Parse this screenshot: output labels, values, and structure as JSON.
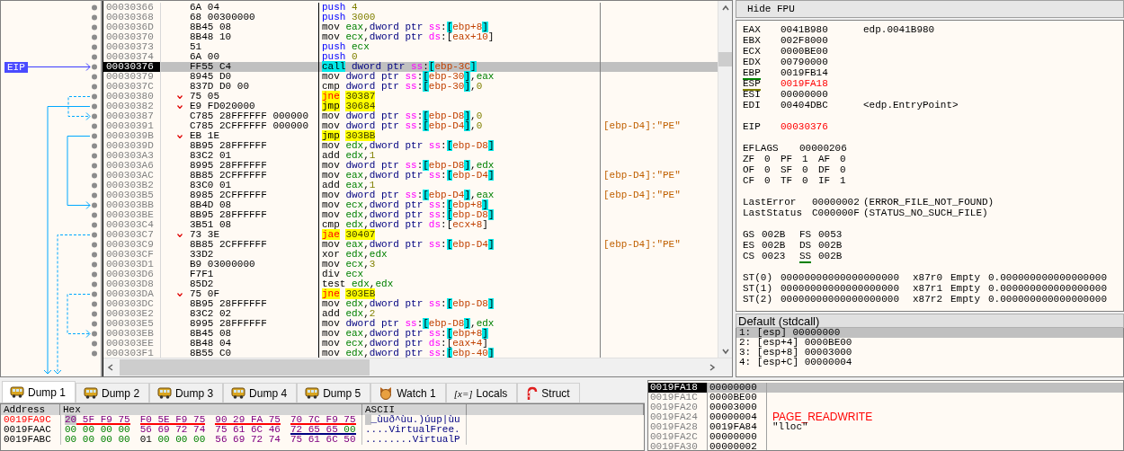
{
  "disassembly": {
    "eip_label": "EIP",
    "rows": [
      {
        "address": "00030366",
        "bytes": "6A 04",
        "branch": false,
        "selected": false,
        "tokens": [
          {
            "kind": "push",
            "text": "push "
          },
          {
            "kind": "num",
            "text": "4"
          }
        ]
      },
      {
        "address": "00030368",
        "bytes": "68 00300000",
        "branch": false,
        "selected": false,
        "tokens": [
          {
            "kind": "push",
            "text": "push "
          },
          {
            "kind": "num",
            "text": "3000"
          }
        ]
      },
      {
        "address": "0003036D",
        "bytes": "8B45 08",
        "branch": false,
        "selected": false,
        "tokens": [
          {
            "kind": "op",
            "text": "mov "
          },
          {
            "kind": "reg",
            "text": "eax"
          },
          {
            "kind": "punct",
            "text": ","
          },
          {
            "kind": "ptr",
            "text": "dword ptr "
          },
          {
            "kind": "seg",
            "text": "ss"
          },
          {
            "kind": "punct",
            "text": ":"
          },
          {
            "kind": "bracket",
            "text": "["
          },
          {
            "kind": "mem",
            "text": "ebp+8"
          },
          {
            "kind": "bracket",
            "text": "]"
          }
        ]
      },
      {
        "address": "00030370",
        "bytes": "8B48 10",
        "branch": false,
        "selected": false,
        "tokens": [
          {
            "kind": "op",
            "text": "mov "
          },
          {
            "kind": "reg",
            "text": "ecx"
          },
          {
            "kind": "punct",
            "text": ","
          },
          {
            "kind": "ptr",
            "text": "dword ptr "
          },
          {
            "kind": "seg",
            "text": "ds"
          },
          {
            "kind": "punct",
            "text": ":["
          },
          {
            "kind": "mem",
            "text": "eax+10"
          },
          {
            "kind": "punct",
            "text": "]"
          }
        ]
      },
      {
        "address": "00030373",
        "bytes": "51",
        "branch": false,
        "selected": false,
        "tokens": [
          {
            "kind": "push",
            "text": "push "
          },
          {
            "kind": "reg",
            "text": "ecx"
          }
        ]
      },
      {
        "address": "00030374",
        "bytes": "6A 00",
        "branch": false,
        "selected": false,
        "tokens": [
          {
            "kind": "push",
            "text": "push "
          },
          {
            "kind": "num",
            "text": "0"
          }
        ]
      },
      {
        "address": "00030376",
        "bytes": "FF55 C4",
        "branch": false,
        "selected": true,
        "tokens": [
          {
            "kind": "call",
            "text": "call"
          },
          {
            "kind": "ptr",
            "text": "dword ptr "
          },
          {
            "kind": "seg",
            "text": "ss"
          },
          {
            "kind": "punct",
            "text": ":"
          },
          {
            "kind": "bracket",
            "text": "["
          },
          {
            "kind": "mem",
            "text": "ebp-3C"
          },
          {
            "kind": "bracket",
            "text": "]"
          }
        ]
      },
      {
        "address": "00030379",
        "bytes": "8945 D0",
        "branch": false,
        "selected": false,
        "tokens": [
          {
            "kind": "op",
            "text": "mov "
          },
          {
            "kind": "ptr",
            "text": "dword ptr "
          },
          {
            "kind": "seg",
            "text": "ss"
          },
          {
            "kind": "punct",
            "text": ":"
          },
          {
            "kind": "bracket",
            "text": "["
          },
          {
            "kind": "mem",
            "text": "ebp-30"
          },
          {
            "kind": "bracket",
            "text": "]"
          },
          {
            "kind": "punct",
            "text": ","
          },
          {
            "kind": "reg",
            "text": "eax"
          }
        ]
      },
      {
        "address": "0003037C",
        "bytes": "837D D0 00",
        "branch": false,
        "selected": false,
        "tokens": [
          {
            "kind": "op",
            "text": "cmp "
          },
          {
            "kind": "ptr",
            "text": "dword ptr "
          },
          {
            "kind": "seg",
            "text": "ss"
          },
          {
            "kind": "punct",
            "text": ":"
          },
          {
            "kind": "bracket",
            "text": "["
          },
          {
            "kind": "mem",
            "text": "ebp-30"
          },
          {
            "kind": "bracket",
            "text": "]"
          },
          {
            "kind": "punct",
            "text": ","
          },
          {
            "kind": "num",
            "text": "0"
          }
        ]
      },
      {
        "address": "00030380",
        "bytes": "75 05",
        "branch": true,
        "selected": false,
        "tokens": [
          {
            "kind": "jcc",
            "text": "jne"
          },
          {
            "kind": "target",
            "text": "30387"
          }
        ]
      },
      {
        "address": "00030382",
        "bytes": "E9 FD020000",
        "branch": true,
        "selected": false,
        "tokens": [
          {
            "kind": "jmp",
            "text": "jmp"
          },
          {
            "kind": "target",
            "text": "30684"
          }
        ]
      },
      {
        "address": "00030387",
        "bytes": "C785 28FFFFFF 000000",
        "branch": false,
        "selected": false,
        "tokens": [
          {
            "kind": "op",
            "text": "mov "
          },
          {
            "kind": "ptr",
            "text": "dword ptr "
          },
          {
            "kind": "seg",
            "text": "ss"
          },
          {
            "kind": "punct",
            "text": ":"
          },
          {
            "kind": "bracket",
            "text": "["
          },
          {
            "kind": "mem",
            "text": "ebp-D8"
          },
          {
            "kind": "bracket",
            "text": "]"
          },
          {
            "kind": "punct",
            "text": ","
          },
          {
            "kind": "num",
            "text": "0"
          }
        ]
      },
      {
        "address": "00030391",
        "bytes": "C785 2CFFFFFF 000000",
        "branch": false,
        "selected": false,
        "tokens": [
          {
            "kind": "op",
            "text": "mov "
          },
          {
            "kind": "ptr",
            "text": "dword ptr "
          },
          {
            "kind": "seg",
            "text": "ss"
          },
          {
            "kind": "punct",
            "text": ":"
          },
          {
            "kind": "bracket",
            "text": "["
          },
          {
            "kind": "mem",
            "text": "ebp-D4"
          },
          {
            "kind": "bracket",
            "text": "]"
          },
          {
            "kind": "punct",
            "text": ","
          },
          {
            "kind": "num",
            "text": "0"
          }
        ],
        "comment": "[ebp-D4]:\"PE\""
      },
      {
        "address": "0003039B",
        "bytes": "EB 1E",
        "branch": true,
        "selected": false,
        "tokens": [
          {
            "kind": "jmp",
            "text": "jmp"
          },
          {
            "kind": "target",
            "text": "303BB"
          }
        ]
      },
      {
        "address": "0003039D",
        "bytes": "8B95 28FFFFFF",
        "branch": false,
        "selected": false,
        "tokens": [
          {
            "kind": "op",
            "text": "mov "
          },
          {
            "kind": "reg",
            "text": "edx"
          },
          {
            "kind": "punct",
            "text": ","
          },
          {
            "kind": "ptr",
            "text": "dword ptr "
          },
          {
            "kind": "seg",
            "text": "ss"
          },
          {
            "kind": "punct",
            "text": ":"
          },
          {
            "kind": "bracket",
            "text": "["
          },
          {
            "kind": "mem",
            "text": "ebp-D8"
          },
          {
            "kind": "bracket",
            "text": "]"
          }
        ]
      },
      {
        "address": "000303A3",
        "bytes": "83C2 01",
        "branch": false,
        "selected": false,
        "tokens": [
          {
            "kind": "op",
            "text": "add "
          },
          {
            "kind": "reg",
            "text": "edx"
          },
          {
            "kind": "punct",
            "text": ","
          },
          {
            "kind": "num",
            "text": "1"
          }
        ]
      },
      {
        "address": "000303A6",
        "bytes": "8995 28FFFFFF",
        "branch": false,
        "selected": false,
        "tokens": [
          {
            "kind": "op",
            "text": "mov "
          },
          {
            "kind": "ptr",
            "text": "dword ptr "
          },
          {
            "kind": "seg",
            "text": "ss"
          },
          {
            "kind": "punct",
            "text": ":"
          },
          {
            "kind": "bracket",
            "text": "["
          },
          {
            "kind": "mem",
            "text": "ebp-D8"
          },
          {
            "kind": "bracket",
            "text": "]"
          },
          {
            "kind": "punct",
            "text": ","
          },
          {
            "kind": "reg",
            "text": "edx"
          }
        ]
      },
      {
        "address": "000303AC",
        "bytes": "8B85 2CFFFFFF",
        "branch": false,
        "selected": false,
        "tokens": [
          {
            "kind": "op",
            "text": "mov "
          },
          {
            "kind": "reg",
            "text": "eax"
          },
          {
            "kind": "punct",
            "text": ","
          },
          {
            "kind": "ptr",
            "text": "dword ptr "
          },
          {
            "kind": "seg",
            "text": "ss"
          },
          {
            "kind": "punct",
            "text": ":"
          },
          {
            "kind": "bracket",
            "text": "["
          },
          {
            "kind": "mem",
            "text": "ebp-D4"
          },
          {
            "kind": "bracket",
            "text": "]"
          }
        ],
        "comment": "[ebp-D4]:\"PE\""
      },
      {
        "address": "000303B2",
        "bytes": "83C0 01",
        "branch": false,
        "selected": false,
        "tokens": [
          {
            "kind": "op",
            "text": "add "
          },
          {
            "kind": "reg",
            "text": "eax"
          },
          {
            "kind": "punct",
            "text": ","
          },
          {
            "kind": "num",
            "text": "1"
          }
        ]
      },
      {
        "address": "000303B5",
        "bytes": "8985 2CFFFFFF",
        "branch": false,
        "selected": false,
        "tokens": [
          {
            "kind": "op",
            "text": "mov "
          },
          {
            "kind": "ptr",
            "text": "dword ptr "
          },
          {
            "kind": "seg",
            "text": "ss"
          },
          {
            "kind": "punct",
            "text": ":"
          },
          {
            "kind": "bracket",
            "text": "["
          },
          {
            "kind": "mem",
            "text": "ebp-D4"
          },
          {
            "kind": "bracket",
            "text": "]"
          },
          {
            "kind": "punct",
            "text": ","
          },
          {
            "kind": "reg",
            "text": "eax"
          }
        ],
        "comment": "[ebp-D4]:\"PE\""
      },
      {
        "address": "000303BB",
        "bytes": "8B4D 08",
        "branch": false,
        "selected": false,
        "tokens": [
          {
            "kind": "op",
            "text": "mov "
          },
          {
            "kind": "reg",
            "text": "ecx"
          },
          {
            "kind": "punct",
            "text": ","
          },
          {
            "kind": "ptr",
            "text": "dword ptr "
          },
          {
            "kind": "seg",
            "text": "ss"
          },
          {
            "kind": "punct",
            "text": ":"
          },
          {
            "kind": "bracket",
            "text": "["
          },
          {
            "kind": "mem",
            "text": "ebp+8"
          },
          {
            "kind": "bracket",
            "text": "]"
          }
        ]
      },
      {
        "address": "000303BE",
        "bytes": "8B95 28FFFFFF",
        "branch": false,
        "selected": false,
        "tokens": [
          {
            "kind": "op",
            "text": "mov "
          },
          {
            "kind": "reg",
            "text": "edx"
          },
          {
            "kind": "punct",
            "text": ","
          },
          {
            "kind": "ptr",
            "text": "dword ptr "
          },
          {
            "kind": "seg",
            "text": "ss"
          },
          {
            "kind": "punct",
            "text": ":"
          },
          {
            "kind": "bracket",
            "text": "["
          },
          {
            "kind": "mem",
            "text": "ebp-D8"
          },
          {
            "kind": "bracket",
            "text": "]"
          }
        ]
      },
      {
        "address": "000303C4",
        "bytes": "3B51 08",
        "branch": false,
        "selected": false,
        "tokens": [
          {
            "kind": "op",
            "text": "cmp "
          },
          {
            "kind": "reg",
            "text": "edx"
          },
          {
            "kind": "punct",
            "text": ","
          },
          {
            "kind": "ptr",
            "text": "dword ptr "
          },
          {
            "kind": "seg",
            "text": "ds"
          },
          {
            "kind": "punct",
            "text": ":["
          },
          {
            "kind": "mem",
            "text": "ecx+8"
          },
          {
            "kind": "punct",
            "text": "]"
          }
        ]
      },
      {
        "address": "000303C7",
        "bytes": "73 3E",
        "branch": true,
        "selected": false,
        "tokens": [
          {
            "kind": "jcc",
            "text": "jae"
          },
          {
            "kind": "target",
            "text": "30407"
          }
        ]
      },
      {
        "address": "000303C9",
        "bytes": "8B85 2CFFFFFF",
        "branch": false,
        "selected": false,
        "tokens": [
          {
            "kind": "op",
            "text": "mov "
          },
          {
            "kind": "reg",
            "text": "eax"
          },
          {
            "kind": "punct",
            "text": ","
          },
          {
            "kind": "ptr",
            "text": "dword ptr "
          },
          {
            "kind": "seg",
            "text": "ss"
          },
          {
            "kind": "punct",
            "text": ":"
          },
          {
            "kind": "bracket",
            "text": "["
          },
          {
            "kind": "mem",
            "text": "ebp-D4"
          },
          {
            "kind": "bracket",
            "text": "]"
          }
        ],
        "comment": "[ebp-D4]:\"PE\""
      },
      {
        "address": "000303CF",
        "bytes": "33D2",
        "branch": false,
        "selected": false,
        "tokens": [
          {
            "kind": "op",
            "text": "xor "
          },
          {
            "kind": "reg",
            "text": "edx"
          },
          {
            "kind": "punct",
            "text": ","
          },
          {
            "kind": "reg",
            "text": "edx"
          }
        ]
      },
      {
        "address": "000303D1",
        "bytes": "B9 03000000",
        "branch": false,
        "selected": false,
        "tokens": [
          {
            "kind": "op",
            "text": "mov "
          },
          {
            "kind": "reg",
            "text": "ecx"
          },
          {
            "kind": "punct",
            "text": ","
          },
          {
            "kind": "num",
            "text": "3"
          }
        ]
      },
      {
        "address": "000303D6",
        "bytes": "F7F1",
        "branch": false,
        "selected": false,
        "tokens": [
          {
            "kind": "op",
            "text": "div "
          },
          {
            "kind": "reg",
            "text": "ecx"
          }
        ]
      },
      {
        "address": "000303D8",
        "bytes": "85D2",
        "branch": false,
        "selected": false,
        "tokens": [
          {
            "kind": "op",
            "text": "test "
          },
          {
            "kind": "reg",
            "text": "edx"
          },
          {
            "kind": "punct",
            "text": ","
          },
          {
            "kind": "reg",
            "text": "edx"
          }
        ]
      },
      {
        "address": "000303DA",
        "bytes": "75 0F",
        "branch": true,
        "selected": false,
        "tokens": [
          {
            "kind": "jcc",
            "text": "jne"
          },
          {
            "kind": "target",
            "text": "303EB"
          }
        ]
      },
      {
        "address": "000303DC",
        "bytes": "8B95 28FFFFFF",
        "branch": false,
        "selected": false,
        "tokens": [
          {
            "kind": "op",
            "text": "mov "
          },
          {
            "kind": "reg",
            "text": "edx"
          },
          {
            "kind": "punct",
            "text": ","
          },
          {
            "kind": "ptr",
            "text": "dword ptr "
          },
          {
            "kind": "seg",
            "text": "ss"
          },
          {
            "kind": "punct",
            "text": ":"
          },
          {
            "kind": "bracket",
            "text": "["
          },
          {
            "kind": "mem",
            "text": "ebp-D8"
          },
          {
            "kind": "bracket",
            "text": "]"
          }
        ]
      },
      {
        "address": "000303E2",
        "bytes": "83C2 02",
        "branch": false,
        "selected": false,
        "tokens": [
          {
            "kind": "op",
            "text": "add "
          },
          {
            "kind": "reg",
            "text": "edx"
          },
          {
            "kind": "punct",
            "text": ","
          },
          {
            "kind": "num",
            "text": "2"
          }
        ]
      },
      {
        "address": "000303E5",
        "bytes": "8995 28FFFFFF",
        "branch": false,
        "selected": false,
        "tokens": [
          {
            "kind": "op",
            "text": "mov "
          },
          {
            "kind": "ptr",
            "text": "dword ptr "
          },
          {
            "kind": "seg",
            "text": "ss"
          },
          {
            "kind": "punct",
            "text": ":"
          },
          {
            "kind": "bracket",
            "text": "["
          },
          {
            "kind": "mem",
            "text": "ebp-D8"
          },
          {
            "kind": "bracket",
            "text": "]"
          },
          {
            "kind": "punct",
            "text": ","
          },
          {
            "kind": "reg",
            "text": "edx"
          }
        ]
      },
      {
        "address": "000303EB",
        "bytes": "8B45 08",
        "branch": false,
        "selected": false,
        "tokens": [
          {
            "kind": "op",
            "text": "mov "
          },
          {
            "kind": "reg",
            "text": "eax"
          },
          {
            "kind": "punct",
            "text": ","
          },
          {
            "kind": "ptr",
            "text": "dword ptr "
          },
          {
            "kind": "seg",
            "text": "ss"
          },
          {
            "kind": "punct",
            "text": ":"
          },
          {
            "kind": "bracket",
            "text": "["
          },
          {
            "kind": "mem",
            "text": "ebp+8"
          },
          {
            "kind": "bracket",
            "text": "]"
          }
        ]
      },
      {
        "address": "000303EE",
        "bytes": "8B48 04",
        "branch": false,
        "selected": false,
        "tokens": [
          {
            "kind": "op",
            "text": "mov "
          },
          {
            "kind": "reg",
            "text": "ecx"
          },
          {
            "kind": "punct",
            "text": ","
          },
          {
            "kind": "ptr",
            "text": "dword ptr "
          },
          {
            "kind": "seg",
            "text": "ds"
          },
          {
            "kind": "punct",
            "text": ":["
          },
          {
            "kind": "mem",
            "text": "eax+4"
          },
          {
            "kind": "punct",
            "text": "]"
          }
        ]
      },
      {
        "address": "000303F1",
        "bytes": "8B55 C0",
        "branch": false,
        "selected": false,
        "tokens": [
          {
            "kind": "op",
            "text": "mov "
          },
          {
            "kind": "reg",
            "text": "edx"
          },
          {
            "kind": "punct",
            "text": ","
          },
          {
            "kind": "ptr",
            "text": "dword ptr "
          },
          {
            "kind": "seg",
            "text": "ss"
          },
          {
            "kind": "punct",
            "text": ":"
          },
          {
            "kind": "bracket",
            "text": "["
          },
          {
            "kind": "mem",
            "text": "ebp-40"
          },
          {
            "kind": "bracket",
            "text": "]"
          }
        ]
      }
    ]
  },
  "registers_panel": {
    "button": "Hide FPU",
    "registers": [
      {
        "name": "EAX",
        "value": "0041B980",
        "changed": false,
        "comment": "edp.0041B980"
      },
      {
        "name": "EBX",
        "value": "002F8000",
        "changed": false
      },
      {
        "name": "ECX",
        "value": "0000BE00",
        "changed": false
      },
      {
        "name": "EDX",
        "value": "00790000",
        "changed": false
      },
      {
        "name": "EBP",
        "value": "0019FB14",
        "changed": false,
        "color": "#008000"
      },
      {
        "name": "ESP",
        "value": "0019FA18",
        "changed": true,
        "color": "#808000"
      },
      {
        "name": "ESI",
        "value": "00000000",
        "changed": false
      },
      {
        "name": "EDI",
        "value": "00404DBC",
        "changed": false,
        "comment": "<edp.EntryPoint>"
      }
    ],
    "eip": {
      "name": "EIP",
      "value": "00030376",
      "changed": true
    },
    "eflags": {
      "name": "EFLAGS",
      "value": "00000206"
    },
    "flags": [
      [
        {
          "name": "ZF",
          "value": "0"
        },
        {
          "name": "PF",
          "value": "1"
        },
        {
          "name": "AF",
          "value": "0"
        }
      ],
      [
        {
          "name": "OF",
          "value": "0"
        },
        {
          "name": "SF",
          "value": "0"
        },
        {
          "name": "DF",
          "value": "0"
        }
      ],
      [
        {
          "name": "CF",
          "value": "0"
        },
        {
          "name": "TF",
          "value": "0"
        },
        {
          "name": "IF",
          "value": "1"
        }
      ]
    ],
    "errors": [
      {
        "name": "LastError",
        "value": "00000002",
        "comment": "(ERROR_FILE_NOT_FOUND)"
      },
      {
        "name": "LastStatus",
        "value": "C000000F",
        "comment": "(STATUS_NO_SUCH_FILE)"
      }
    ],
    "segments": [
      [
        {
          "name": "GS",
          "value": "002B"
        },
        {
          "name": "FS",
          "value": "0053"
        }
      ],
      [
        {
          "name": "ES",
          "value": "002B"
        },
        {
          "name": "DS",
          "value": "002B"
        }
      ],
      [
        {
          "name": "CS",
          "value": "0023"
        },
        {
          "name": "SS",
          "value": "002B",
          "color": "#008000"
        }
      ]
    ],
    "fpu": [
      {
        "name": "ST(0)",
        "value": "00000000000000000000",
        "tag": "x87r0",
        "state": "Empty",
        "float": "0.000000000000000000"
      },
      {
        "name": "ST(1)",
        "value": "00000000000000000000",
        "tag": "x87r1",
        "state": "Empty",
        "float": "0.000000000000000000"
      },
      {
        "name": "ST(2)",
        "value": "00000000000000000000",
        "tag": "x87r2",
        "state": "Empty",
        "float": "0.000000000000000000"
      }
    ]
  },
  "call_panel": {
    "title": "Default (stdcall)",
    "args": [
      {
        "index": "1:",
        "location": "[esp]",
        "value": "00000000",
        "selected": true
      },
      {
        "index": "2:",
        "location": "[esp+4]",
        "value": "0000BE00",
        "selected": false
      },
      {
        "index": "3:",
        "location": "[esp+8]",
        "value": "00003000",
        "selected": false
      },
      {
        "index": "4:",
        "location": "[esp+C]",
        "value": "00000004",
        "selected": false
      }
    ]
  },
  "dump_tabs": [
    {
      "label": "Dump 1",
      "kind": "dump",
      "selected": true
    },
    {
      "label": "Dump 2",
      "kind": "dump",
      "selected": false
    },
    {
      "label": "Dump 3",
      "kind": "dump",
      "selected": false
    },
    {
      "label": "Dump 4",
      "kind": "dump",
      "selected": false
    },
    {
      "label": "Dump 5",
      "kind": "dump",
      "selected": false
    },
    {
      "label": "Watch 1",
      "kind": "watch",
      "selected": false
    },
    {
      "label": "Locals",
      "kind": "locals",
      "icon_text": "[x=]",
      "selected": false
    },
    {
      "label": "Struct",
      "kind": "struct",
      "selected": false
    }
  ],
  "dump": {
    "columns": [
      "Address",
      "Hex",
      "ASCII"
    ],
    "rows": [
      {
        "address": "0019FA9C",
        "selected": true,
        "ascii": " _ùuð^ùu.)úup|ùu",
        "groups": [
          {
            "color": "#ff0000",
            "bytes": [
              {
                "kind": "printable",
                "text": "20"
              },
              {
                "kind": "printable",
                "text": "5F"
              },
              {
                "kind": "printable",
                "text": "F9"
              },
              {
                "kind": "printable",
                "text": "75"
              }
            ]
          },
          {
            "color": "#ff0000",
            "bytes": [
              {
                "kind": "printable",
                "text": "F0"
              },
              {
                "kind": "printable",
                "text": "5E"
              },
              {
                "kind": "printable",
                "text": "F9"
              },
              {
                "kind": "printable",
                "text": "75"
              }
            ]
          },
          {
            "color": "#ff0000",
            "bytes": [
              {
                "kind": "printable",
                "text": "90"
              },
              {
                "kind": "printable",
                "text": "29"
              },
              {
                "kind": "printable",
                "text": "FA"
              },
              {
                "kind": "printable",
                "text": "75"
              }
            ]
          },
          {
            "color": "#ff0000",
            "bytes": [
              {
                "kind": "printable",
                "text": "70"
              },
              {
                "kind": "printable",
                "text": "7C"
              },
              {
                "kind": "printable",
                "text": "F9"
              },
              {
                "kind": "printable",
                "text": "75"
              }
            ]
          }
        ]
      },
      {
        "address": "0019FAAC",
        "selected": false,
        "ascii": "....VirtualFree.",
        "groups": [
          {
            "bytes": [
              {
                "kind": "zero",
                "text": "00"
              },
              {
                "kind": "zero",
                "text": "00"
              },
              {
                "kind": "zero",
                "text": "00"
              },
              {
                "kind": "zero",
                "text": "00"
              }
            ]
          },
          {
            "bytes": [
              {
                "kind": "printable",
                "text": "56"
              },
              {
                "kind": "printable",
                "text": "69"
              },
              {
                "kind": "printable",
                "text": "72"
              },
              {
                "kind": "printable",
                "text": "74"
              }
            ]
          },
          {
            "bytes": [
              {
                "kind": "printable",
                "text": "75"
              },
              {
                "kind": "printable",
                "text": "61"
              },
              {
                "kind": "printable",
                "text": "6C"
              },
              {
                "kind": "printable",
                "text": "46"
              }
            ]
          },
          {
            "color": "#000080",
            "bytes": [
              {
                "kind": "printable",
                "text": "72"
              },
              {
                "kind": "printable",
                "text": "65"
              },
              {
                "kind": "printable",
                "text": "65"
              },
              {
                "kind": "zero",
                "text": "00"
              }
            ]
          }
        ]
      },
      {
        "address": "0019FABC",
        "selected": false,
        "ascii": "........VirtualP",
        "groups": [
          {
            "bytes": [
              {
                "kind": "zero",
                "text": "00"
              },
              {
                "kind": "zero",
                "text": "00"
              },
              {
                "kind": "zero",
                "text": "00"
              },
              {
                "kind": "zero",
                "text": "00"
              }
            ]
          },
          {
            "bytes": [
              {
                "kind": "control",
                "text": "01"
              },
              {
                "kind": "zero",
                "text": "00"
              },
              {
                "kind": "zero",
                "text": "00"
              },
              {
                "kind": "zero",
                "text": "00"
              }
            ]
          },
          {
            "bytes": [
              {
                "kind": "printable",
                "text": "56"
              },
              {
                "kind": "printable",
                "text": "69"
              },
              {
                "kind": "printable",
                "text": "72"
              },
              {
                "kind": "printable",
                "text": "74"
              }
            ]
          },
          {
            "bytes": [
              {
                "kind": "printable",
                "text": "75"
              },
              {
                "kind": "printable",
                "text": "61"
              },
              {
                "kind": "printable",
                "text": "6C"
              },
              {
                "kind": "printable",
                "text": "50"
              }
            ]
          }
        ]
      }
    ]
  },
  "stack": {
    "rows": [
      {
        "address": "0019FA18",
        "value": "00000000",
        "selected": true
      },
      {
        "address": "0019FA1C",
        "value": "0000BE00",
        "selected": false
      },
      {
        "address": "0019FA20",
        "value": "00003000",
        "selected": false
      },
      {
        "address": "0019FA24",
        "value": "00000004",
        "selected": false,
        "comment": "PAGE_READWRITE",
        "kind": "constant"
      },
      {
        "address": "0019FA28",
        "value": "0019FA84",
        "selected": false,
        "comment": "\"lloc\"",
        "kind": "string"
      },
      {
        "address": "0019FA2C",
        "value": "00000000",
        "selected": false
      },
      {
        "address": "0019FA30",
        "value": "00000002",
        "selected": false
      }
    ]
  }
}
